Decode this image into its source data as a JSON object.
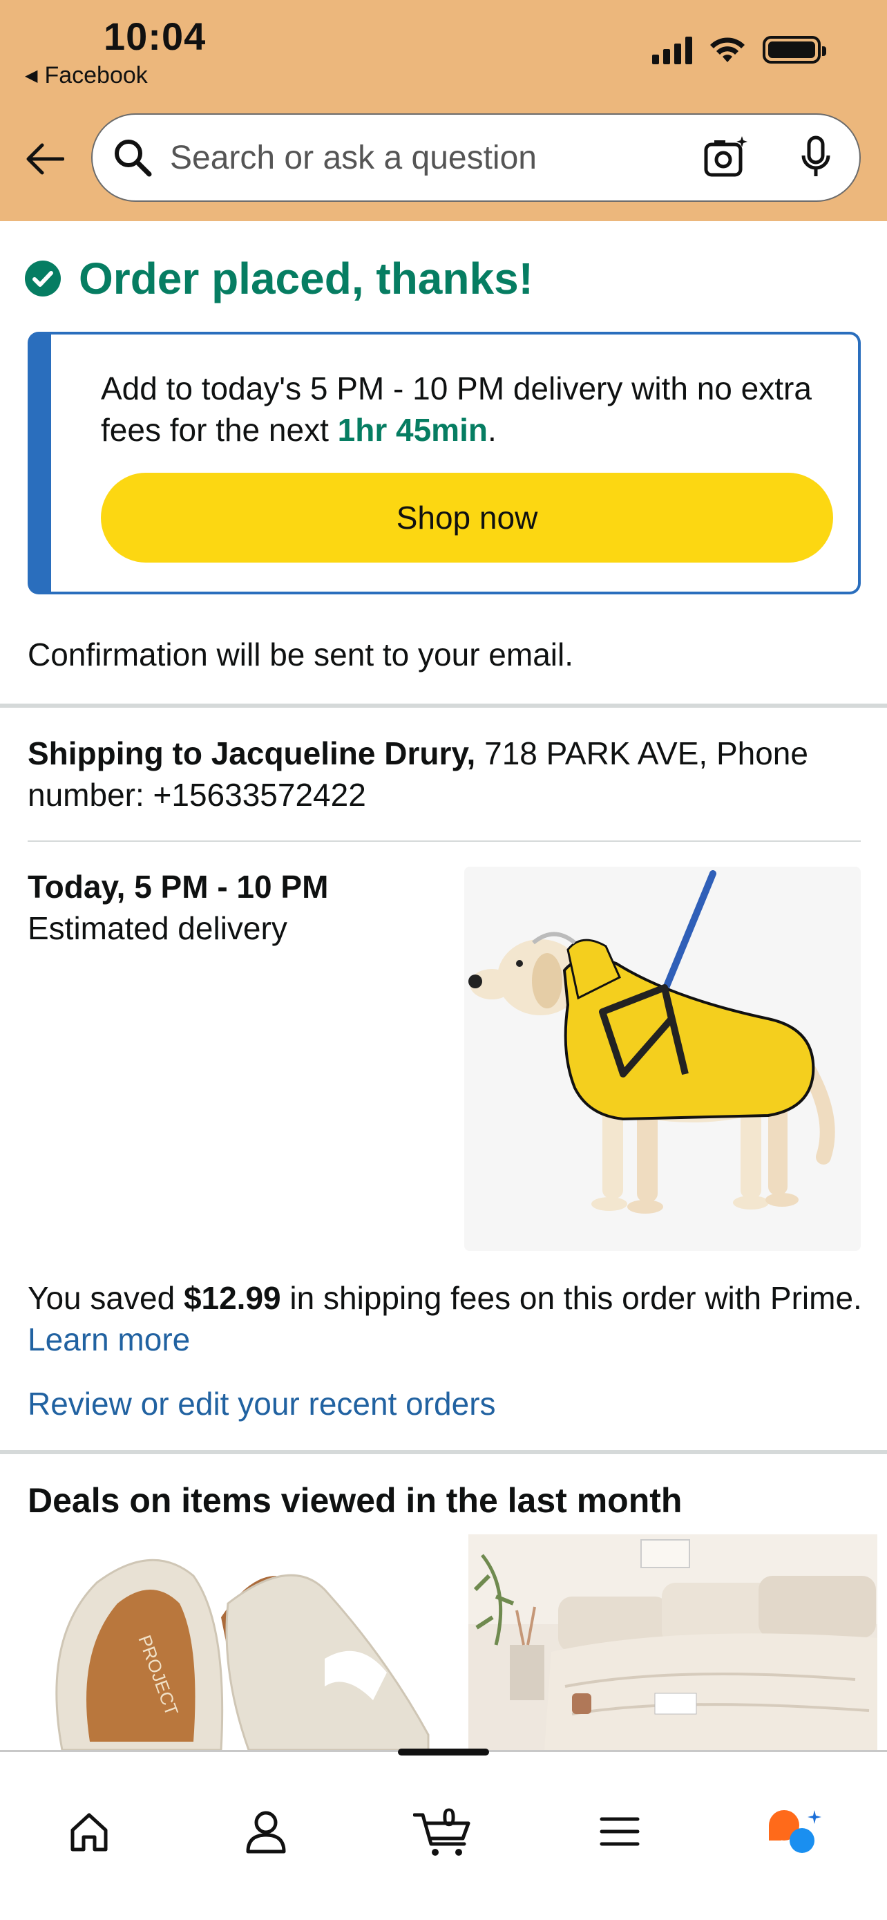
{
  "status_bar": {
    "time": "10:04",
    "back_app_label": "Facebook"
  },
  "search": {
    "placeholder": "Search or ask a question"
  },
  "order": {
    "title": "Order placed, thanks!"
  },
  "promo": {
    "text_before": "Add to today's 5 PM - 10 PM delivery with no extra fees for the next ",
    "highlight": "1hr 45min",
    "text_after": ".",
    "button_label": "Shop now"
  },
  "confirmation_text": "Confirmation will be sent to your email.",
  "shipping": {
    "name_label": "Shipping to Jacqueline Drury,",
    "address": " 718 PARK AVE, Phone number: +15633572422"
  },
  "delivery": {
    "when": "Today, 5 PM - 10 PM",
    "sub": "Estimated delivery"
  },
  "savings": {
    "prefix": "You saved ",
    "amount": "$12.99",
    "suffix": " in shipping fees on this order with Prime. ",
    "learn_more": "Learn more"
  },
  "review_link": "Review or edit your recent orders",
  "deals": {
    "title": "Deals on items viewed in the last month"
  },
  "bottom_nav": {
    "cart_count": "0"
  },
  "colors": {
    "header_bg": "#ecb77c",
    "success_green": "#067d62",
    "promo_blue": "#2a6ebd",
    "button_yellow": "#fcd712",
    "link_blue": "#2162a1"
  }
}
